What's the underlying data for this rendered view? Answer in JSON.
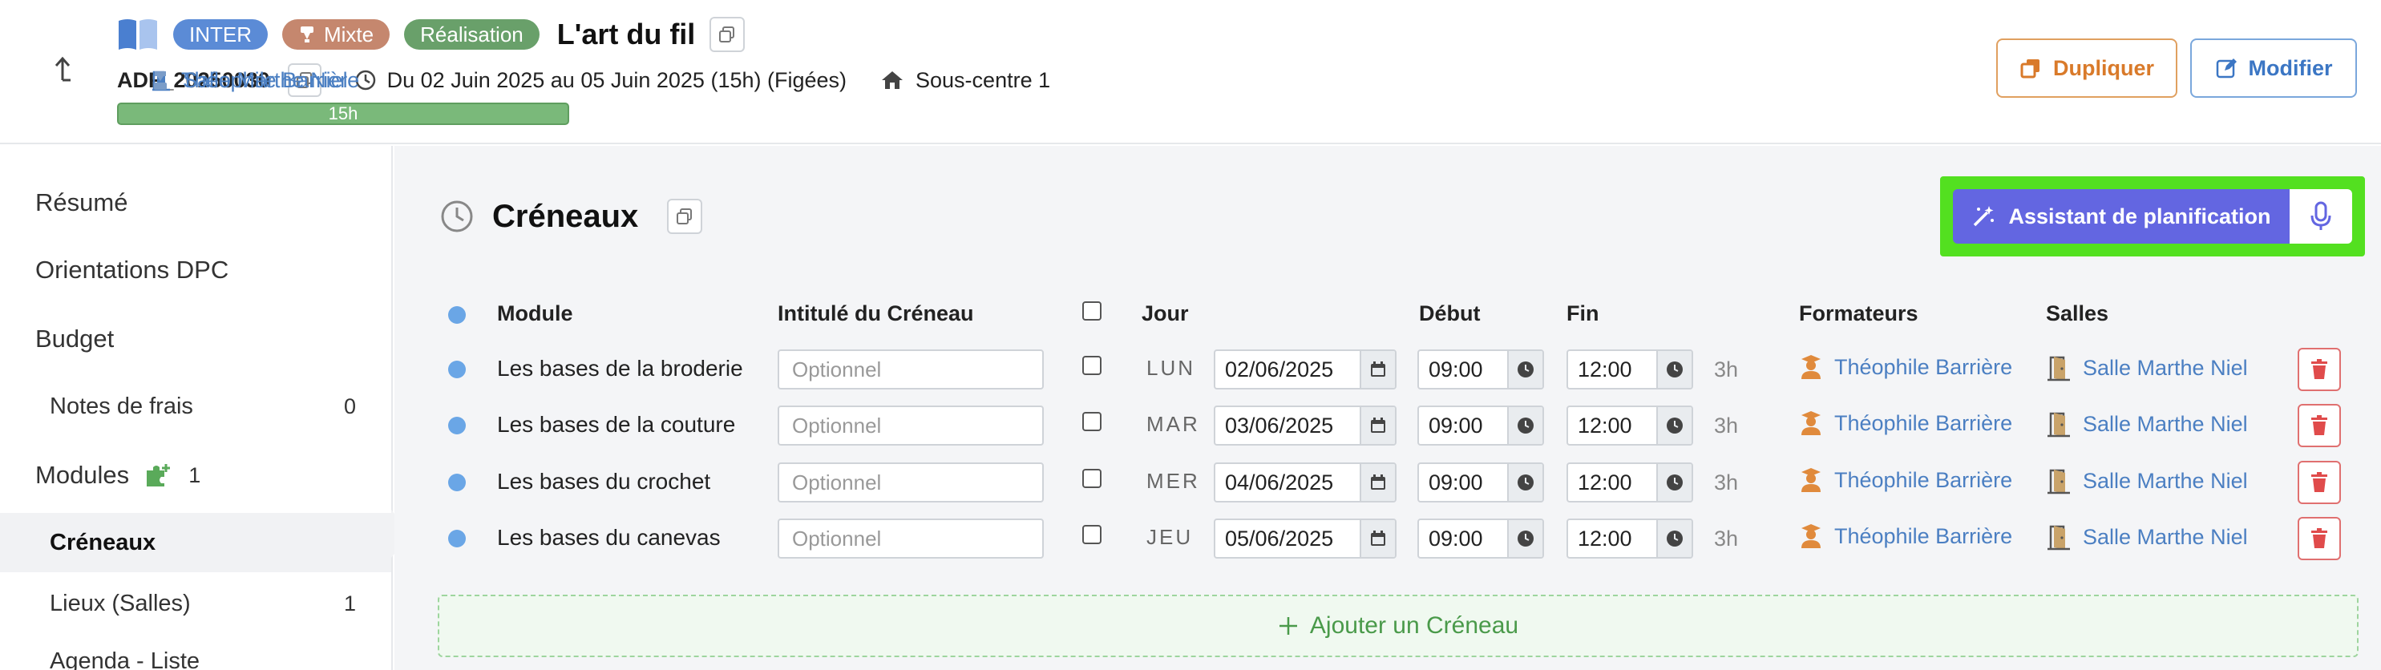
{
  "header": {
    "badges": {
      "inter": "INTER",
      "mixte": "Mixte",
      "realisation": "Réalisation"
    },
    "title": "L'art du fil",
    "reference": "ADF_20250030",
    "dates": "Du 02 Juin 2025 au 05 Juin 2025 (15h) (Figées)",
    "site": "Sous-centre 1",
    "room": "Salle Marthe Niel",
    "trainer": "Théophile Barrière",
    "progress_label": "15h",
    "progress_fraction": 1.0,
    "duplicate_label": "Dupliquer",
    "modify_label": "Modifier"
  },
  "sidebar": {
    "items": [
      {
        "label": "Résumé",
        "count": ""
      },
      {
        "label": "Orientations DPC",
        "count": ""
      },
      {
        "label": "Budget",
        "count": ""
      },
      {
        "label": "Notes de frais",
        "count": "0"
      },
      {
        "label": "Modules",
        "count": "1"
      },
      {
        "label": "Créneaux",
        "count": ""
      },
      {
        "label": "Lieux (Salles)",
        "count": "1"
      },
      {
        "label": "Agenda - Liste",
        "count": ""
      }
    ]
  },
  "main": {
    "section_title": "Créneaux",
    "assistant_label": "Assistant de planification",
    "columns": {
      "module": "Module",
      "intitule": "Intitulé du Créneau",
      "jour": "Jour",
      "debut": "Début",
      "fin": "Fin",
      "formateurs": "Formateurs",
      "salles": "Salles"
    },
    "placeholder": "Optionnel",
    "rows": [
      {
        "module": "Les bases de la broderie",
        "day": "LUN",
        "date": "02/06/2025",
        "start": "09:00",
        "end": "12:00",
        "duration": "3h",
        "trainer": "Théophile Barrière",
        "room": "Salle Marthe Niel"
      },
      {
        "module": "Les bases de la couture",
        "day": "MAR",
        "date": "03/06/2025",
        "start": "09:00",
        "end": "12:00",
        "duration": "3h",
        "trainer": "Théophile Barrière",
        "room": "Salle Marthe Niel"
      },
      {
        "module": "Les bases du crochet",
        "day": "MER",
        "date": "04/06/2025",
        "start": "09:00",
        "end": "12:00",
        "duration": "3h",
        "trainer": "Théophile Barrière",
        "room": "Salle Marthe Niel"
      },
      {
        "module": "Les bases du canevas",
        "day": "JEU",
        "date": "05/06/2025",
        "start": "09:00",
        "end": "12:00",
        "duration": "3h",
        "trainer": "Théophile Barrière",
        "room": "Salle Marthe Niel"
      }
    ],
    "add_label": "Ajouter un Créneau"
  },
  "colors": {
    "accent_blue": "#4b7fc2",
    "highlight_green": "#53e020",
    "assistant_purple": "#6366e1",
    "badge_inter": "#5b8bd6",
    "badge_mixte": "#c5876e",
    "badge_realisation": "#69a06a",
    "delete_red": "#e07070"
  }
}
